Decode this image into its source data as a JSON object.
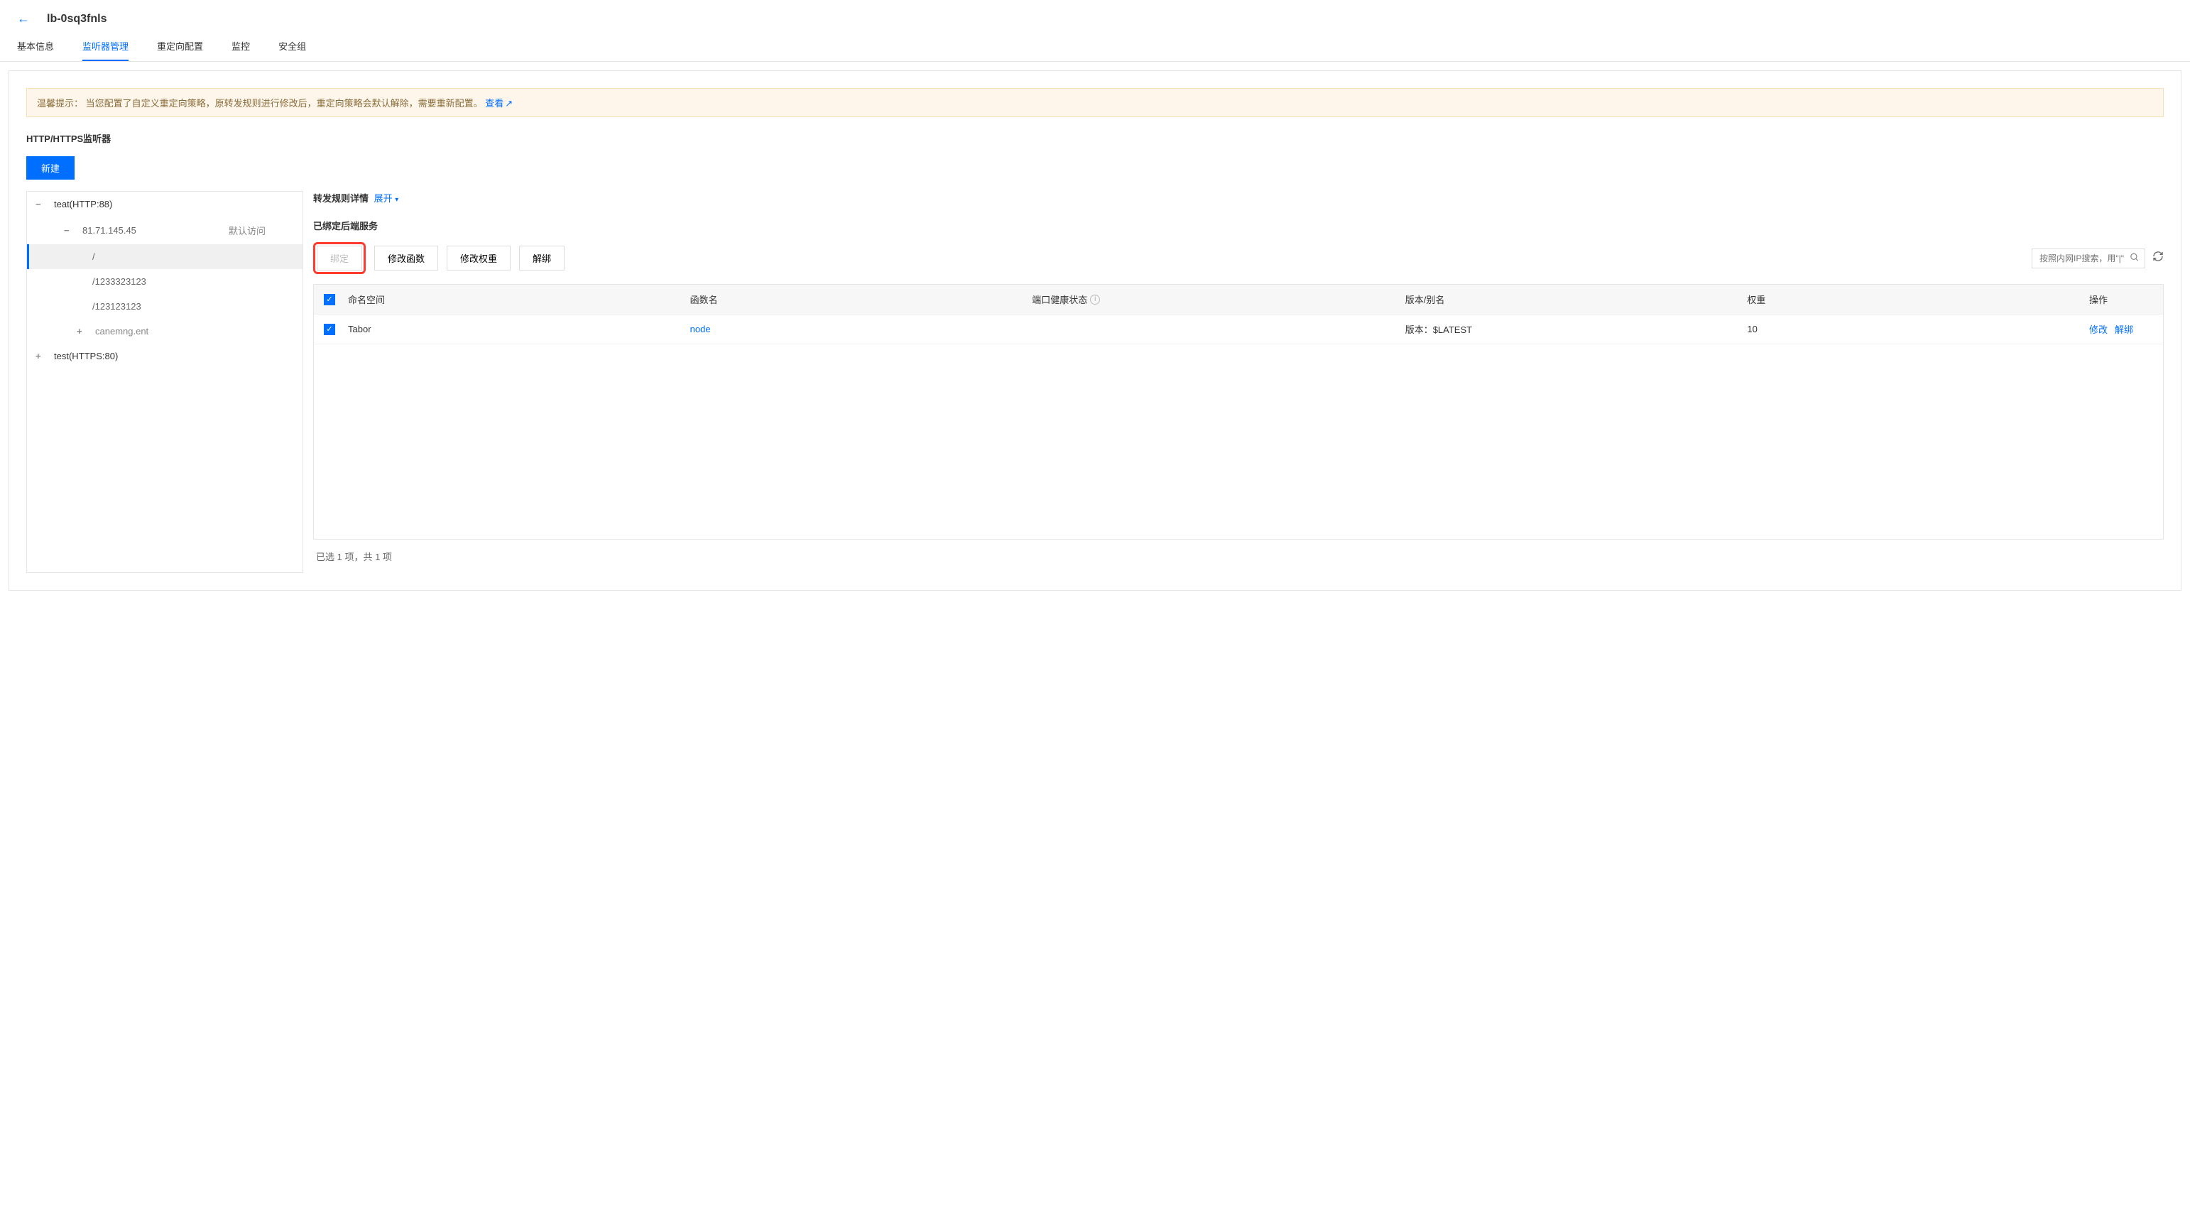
{
  "header": {
    "title": "lb-0sq3fnls"
  },
  "tabs": [
    {
      "label": "基本信息"
    },
    {
      "label": "监听器管理"
    },
    {
      "label": "重定向配置"
    },
    {
      "label": "监控"
    },
    {
      "label": "安全组"
    }
  ],
  "tip": {
    "prefix": "温馨提示：",
    "text": "当您配置了自定义重定向策略，原转发规则进行修改后，重定向策略会默认解除，需要重新配置。",
    "link": "查看"
  },
  "listener_section": {
    "title": "HTTP/HTTPS监听器",
    "create_btn": "新建"
  },
  "tree": {
    "root1": {
      "label": "teat(HTTP:88)"
    },
    "ip": {
      "label": "81.71.145.45",
      "default_tag": "默认访问"
    },
    "paths": [
      {
        "label": "/"
      },
      {
        "label": "/1233323123"
      },
      {
        "label": "/123123123"
      }
    ],
    "add": {
      "label": "canemng.ent"
    },
    "root2": {
      "label": "test(HTTPS:80)"
    }
  },
  "right": {
    "rule_title": "转发规则详情",
    "expand": "展开",
    "bound_title": "已绑定后端服务",
    "buttons": {
      "bind": "绑定",
      "modify_fn": "修改函数",
      "modify_weight": "修改权重",
      "unbind": "解绑"
    },
    "search_placeholder": "按照内网IP搜索，用\"|\"分隔"
  },
  "table": {
    "headers": {
      "ns": "命名空间",
      "fn": "函数名",
      "health": "端口健康状态",
      "ver": "版本/别名",
      "weight": "权重",
      "op": "操作"
    },
    "row": {
      "ns": "Tabor",
      "fn": "node",
      "ver": "版本：$LATEST",
      "weight": "10",
      "op_modify": "修改",
      "op_unbind": "解绑"
    }
  },
  "footer": {
    "text": "已选 1 项，共 1 项"
  }
}
